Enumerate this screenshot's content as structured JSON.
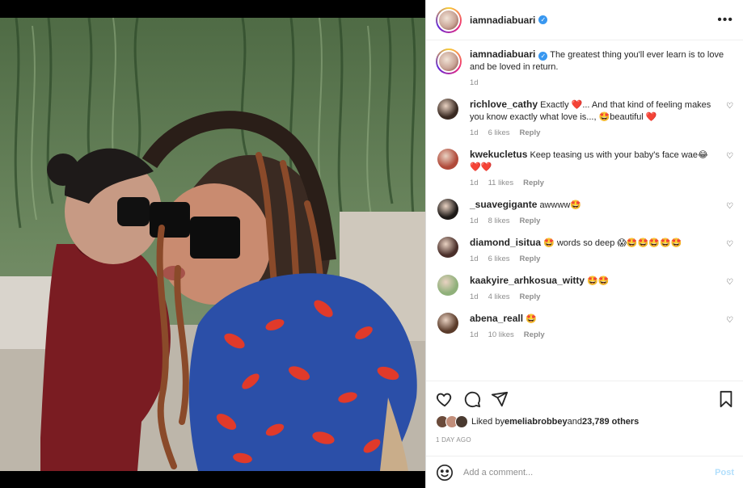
{
  "post": {
    "username": "iamnadiabuari",
    "verified": true,
    "more_icon": "more-horizontal-icon"
  },
  "caption": {
    "username": "iamnadiabuari",
    "text": "The greatest thing you'll ever learn is to love and be loved in return.",
    "time": "1d"
  },
  "comments": [
    {
      "username": "richlove_cathy",
      "text": "Exactly ❤️... And that kind of feeling makes you know exactly what love is..., 🤩beautiful ❤️",
      "time": "1d",
      "likes": "6 likes",
      "reply": "Reply",
      "avatar_color": "#3a2a22"
    },
    {
      "username": "kwekucletus",
      "text": "Keep teasing us with your baby's face wae😂❤️❤️",
      "time": "1d",
      "likes": "11 likes",
      "reply": "Reply",
      "avatar_color": "#b04a3a"
    },
    {
      "username": "_suavegigante",
      "text": "awwww🤩",
      "time": "1d",
      "likes": "8 likes",
      "reply": "Reply",
      "avatar_color": "#1e1a18"
    },
    {
      "username": "diamond_isitua",
      "text": "🤩 words so deep 😱🤩🤩🤩🤩🤩",
      "time": "1d",
      "likes": "6 likes",
      "reply": "Reply",
      "avatar_color": "#4a2f2a"
    },
    {
      "username": "kaakyire_arhkosua_witty",
      "text": "🤩🤩",
      "time": "1d",
      "likes": "4 likes",
      "reply": "Reply",
      "avatar_color": "#8fb07a"
    },
    {
      "username": "abena_reall",
      "text": "🤩",
      "time": "1d",
      "likes": "10 likes",
      "reply": "Reply",
      "avatar_color": "#5a3b2a"
    }
  ],
  "actions": {
    "like_icon": "heart-icon",
    "comment_icon": "comment-icon",
    "share_icon": "share-icon",
    "save_icon": "bookmark-icon"
  },
  "likes": {
    "prefix": "Liked by ",
    "user": "emeliabrobbey",
    "middle": " and ",
    "count": "23,789 others"
  },
  "timestamp": "1 DAY AGO",
  "add_comment": {
    "placeholder": "Add a comment...",
    "post_label": "Post",
    "emoji_icon": "smiley-icon"
  },
  "colors": {
    "link": "#3897f0",
    "post_disabled": "#b2dffc",
    "meta": "#8e8e8e"
  }
}
